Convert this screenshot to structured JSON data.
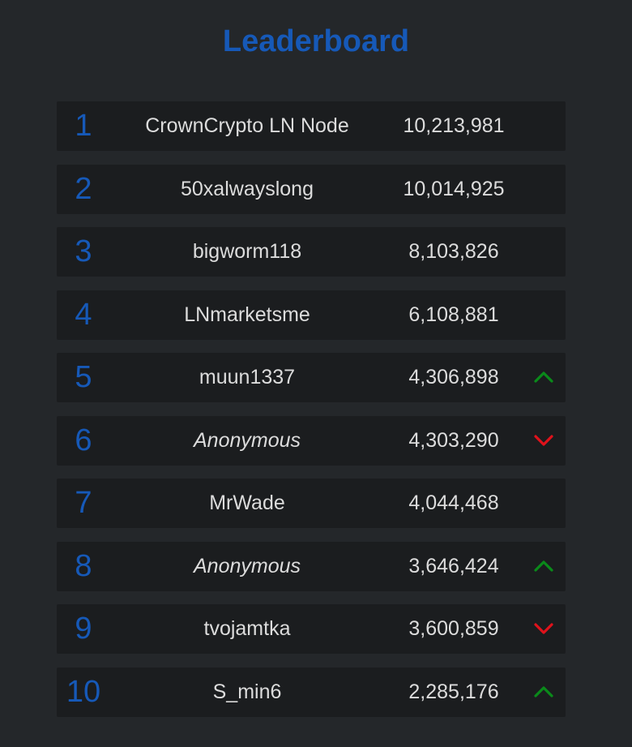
{
  "title": "Leaderboard",
  "colors": {
    "background": "#24272a",
    "row_background": "#1b1d1f",
    "accent": "#1659b8",
    "text": "#dcdcdc",
    "trend_up": "#0a8a1a",
    "trend_down": "#e0121b"
  },
  "entries": [
    {
      "rank": "1",
      "name": "CrownCrypto LN Node",
      "score": "10,213,981",
      "anonymous": false,
      "trend": "none"
    },
    {
      "rank": "2",
      "name": "50xalwayslong",
      "score": "10,014,925",
      "anonymous": false,
      "trend": "none"
    },
    {
      "rank": "3",
      "name": "bigworm118",
      "score": "8,103,826",
      "anonymous": false,
      "trend": "none"
    },
    {
      "rank": "4",
      "name": "LNmarketsme",
      "score": "6,108,881",
      "anonymous": false,
      "trend": "none"
    },
    {
      "rank": "5",
      "name": "muun1337",
      "score": "4,306,898",
      "anonymous": false,
      "trend": "up"
    },
    {
      "rank": "6",
      "name": "Anonymous",
      "score": "4,303,290",
      "anonymous": true,
      "trend": "down"
    },
    {
      "rank": "7",
      "name": "MrWade",
      "score": "4,044,468",
      "anonymous": false,
      "trend": "none"
    },
    {
      "rank": "8",
      "name": "Anonymous",
      "score": "3,646,424",
      "anonymous": true,
      "trend": "up"
    },
    {
      "rank": "9",
      "name": "tvojamtka",
      "score": "3,600,859",
      "anonymous": false,
      "trend": "down"
    },
    {
      "rank": "10",
      "name": "S_min6",
      "score": "2,285,176",
      "anonymous": false,
      "trend": "up"
    }
  ]
}
